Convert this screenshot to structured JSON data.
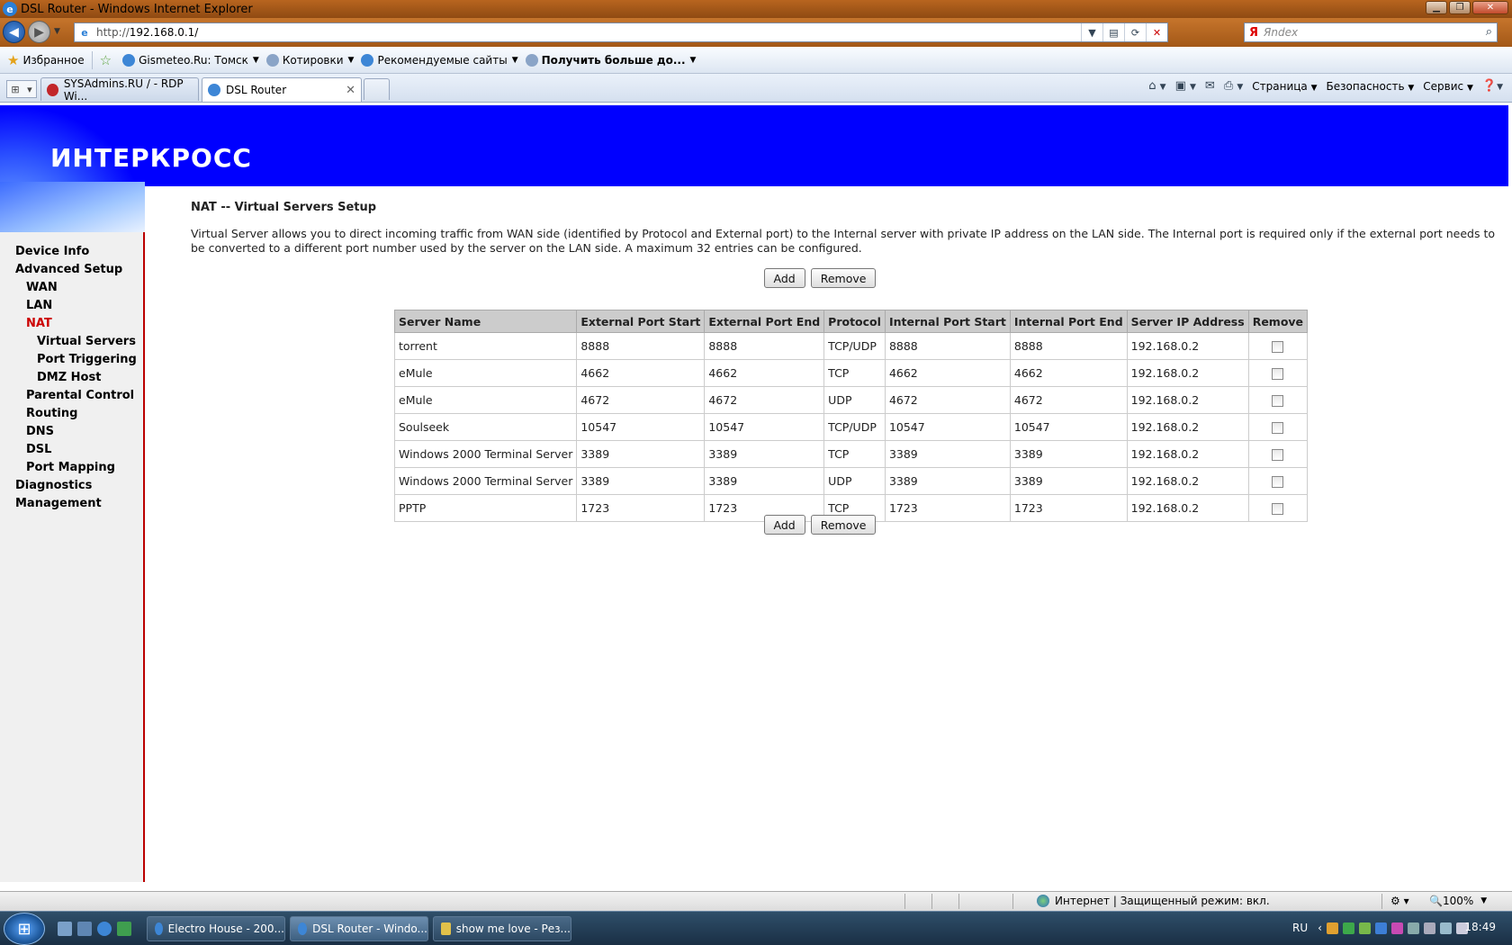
{
  "window": {
    "title": "DSL Router - Windows Internet Explorer"
  },
  "address": {
    "url_prefix": "http://",
    "url_host": "192.168.0.1/"
  },
  "search": {
    "provider": "Я",
    "placeholder": "Яndex"
  },
  "favorites": [
    {
      "label": "Избранное"
    },
    {
      "label": "Gismeteo.Ru: Томск"
    },
    {
      "label": "Котировки"
    },
    {
      "label": "Рекомендуемые сайты"
    },
    {
      "label": "Получить больше до..."
    }
  ],
  "tabs": [
    {
      "label": "SYSAdmins.RU / - RDP Wi..."
    },
    {
      "label": "DSL Router"
    }
  ],
  "command_bar": {
    "page": "Страница",
    "safety": "Безопасность",
    "service": "Сервис"
  },
  "router": {
    "logo": "ИНТЕРКРОСС",
    "nav": [
      {
        "label": "Device Info",
        "level": 0
      },
      {
        "label": "Advanced Setup",
        "level": 0
      },
      {
        "label": "WAN",
        "level": 1
      },
      {
        "label": "LAN",
        "level": 1
      },
      {
        "label": "NAT",
        "level": 1,
        "active": true
      },
      {
        "label": "Virtual Servers",
        "level": 2
      },
      {
        "label": "Port Triggering",
        "level": 2
      },
      {
        "label": "DMZ Host",
        "level": 2
      },
      {
        "label": "Parental Control",
        "level": 1
      },
      {
        "label": "Routing",
        "level": 1
      },
      {
        "label": "DNS",
        "level": 1
      },
      {
        "label": "DSL",
        "level": 1
      },
      {
        "label": "Port Mapping",
        "level": 1
      },
      {
        "label": "Diagnostics",
        "level": 0
      },
      {
        "label": "Management",
        "level": 0
      }
    ],
    "heading": "NAT -- Virtual Servers Setup",
    "description": "Virtual Server allows you to direct incoming traffic from WAN side (identified by Protocol and External port) to the Internal server with private IP address on the LAN side. The Internal port is required only if the external port needs to be converted to a different port number used by the server on the LAN side. A maximum 32 entries can be configured.",
    "add_label": "Add",
    "remove_label": "Remove",
    "columns": [
      "Server Name",
      "External Port Start",
      "External Port End",
      "Protocol",
      "Internal Port Start",
      "Internal Port End",
      "Server IP Address",
      "Remove"
    ],
    "rows": [
      [
        "torrent",
        "8888",
        "8888",
        "TCP/UDP",
        "8888",
        "8888",
        "192.168.0.2"
      ],
      [
        "eMule",
        "4662",
        "4662",
        "TCP",
        "4662",
        "4662",
        "192.168.0.2"
      ],
      [
        "eMule",
        "4672",
        "4672",
        "UDP",
        "4672",
        "4672",
        "192.168.0.2"
      ],
      [
        "Soulseek",
        "10547",
        "10547",
        "TCP/UDP",
        "10547",
        "10547",
        "192.168.0.2"
      ],
      [
        "Windows 2000 Terminal Server",
        "3389",
        "3389",
        "TCP",
        "3389",
        "3389",
        "192.168.0.2"
      ],
      [
        "Windows 2000 Terminal Server",
        "3389",
        "3389",
        "UDP",
        "3389",
        "3389",
        "192.168.0.2"
      ],
      [
        "PPTP",
        "1723",
        "1723",
        "TCP",
        "1723",
        "1723",
        "192.168.0.2"
      ]
    ]
  },
  "status": {
    "zone": "Интернет | Защищенный режим: вкл.",
    "zoom": "100%"
  },
  "taskbar": {
    "items": [
      {
        "label": "Electro House - 200..."
      },
      {
        "label": "DSL Router - Windo...",
        "active": true
      },
      {
        "label": "show me love - Рез..."
      }
    ],
    "lang": "RU",
    "time": "18:49"
  }
}
